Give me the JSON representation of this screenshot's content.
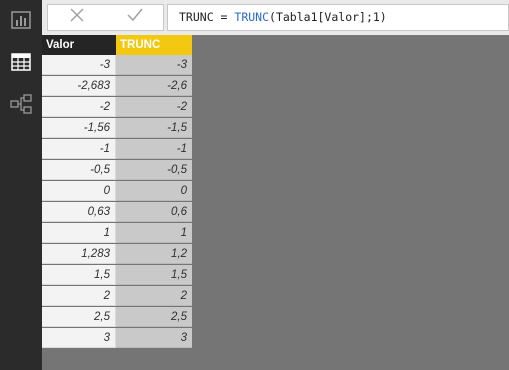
{
  "sidebar": {
    "items": [
      {
        "icon": "report-view-icon"
      },
      {
        "icon": "data-view-icon",
        "active": true
      },
      {
        "icon": "relationships-view-icon"
      }
    ],
    "accent": "#f2c811"
  },
  "toolbar": {
    "cancel_icon": "close-icon",
    "commit_icon": "check-icon"
  },
  "formula": {
    "name": "TRUNC",
    "equals": " = ",
    "function": "TRUNC",
    "args": "(Tabla1[Valor];1)"
  },
  "table": {
    "columns": [
      "Valor",
      "TRUNC"
    ],
    "rows": [
      [
        "-3",
        "-3"
      ],
      [
        "-2,683",
        "-2,6"
      ],
      [
        "-2",
        "-2"
      ],
      [
        "-1,56",
        "-1,5"
      ],
      [
        "-1",
        "-1"
      ],
      [
        "-0,5",
        "-0,5"
      ],
      [
        "0",
        "0"
      ],
      [
        "0,63",
        "0,6"
      ],
      [
        "1",
        "1"
      ],
      [
        "1,283",
        "1,2"
      ],
      [
        "1,5",
        "1,5"
      ],
      [
        "2",
        "2"
      ],
      [
        "2,5",
        "2,5"
      ],
      [
        "3",
        "3"
      ]
    ]
  }
}
